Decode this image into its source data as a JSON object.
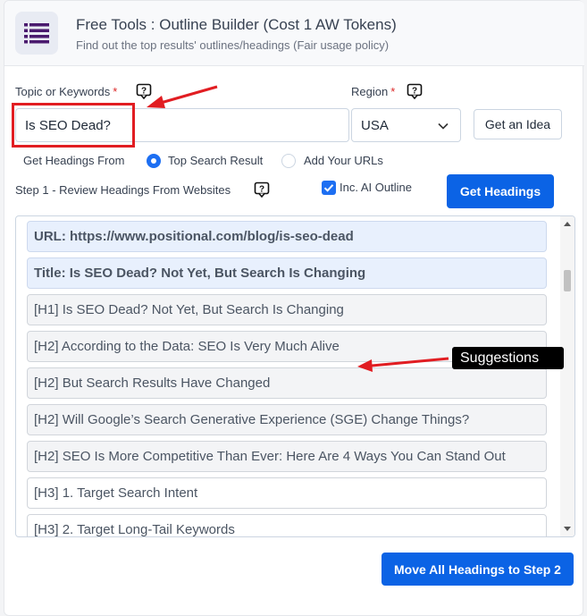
{
  "header": {
    "title": "Free Tools : Outline Builder (Cost 1 AW Tokens)",
    "subtitle": "Find out the top results' outlines/headings (Fair usage policy)",
    "logo_icon": "list-icon"
  },
  "form": {
    "topic_label": "Topic or Keywords",
    "required_mark": "*",
    "topic_value": "Is SEO Dead?",
    "region_label": "Region",
    "region_value": "USA",
    "idea_button": "Get an Idea",
    "get_headings_from_label": "Get Headings From",
    "source_options": [
      {
        "label": "Top Search Result",
        "selected": true
      },
      {
        "label": "Add Your URLs",
        "selected": false
      }
    ],
    "step1_label": "Step 1 - Review Headings From Websites",
    "ai_outline_label": "Inc. AI Outline",
    "ai_outline_checked": true,
    "get_headings_button": "Get Headings"
  },
  "headings": [
    {
      "tag": "",
      "text": "URL: https://www.positional.com/blog/is-seo-dead",
      "kind": "meta"
    },
    {
      "tag": "",
      "text": "Title: Is SEO Dead? Not Yet, But Search Is Changing",
      "kind": "meta"
    },
    {
      "tag": "[H1]",
      "text": "Is SEO Dead? Not Yet, But Search Is Changing",
      "kind": "gray"
    },
    {
      "tag": "[H2]",
      "text": "According to the Data: SEO Is Very Much Alive",
      "kind": "gray"
    },
    {
      "tag": "[H2]",
      "text": "But Search Results Have Changed",
      "kind": "gray"
    },
    {
      "tag": "[H2]",
      "text": "Will Google’s Search Generative Experience (SGE) Change Things?",
      "kind": "gray"
    },
    {
      "tag": "[H2]",
      "text": "SEO Is More Competitive Than Ever: Here Are 4 Ways You Can Stand Out",
      "kind": "gray"
    },
    {
      "tag": "[H3]",
      "text": "1. Target Search Intent",
      "kind": "white"
    },
    {
      "tag": "[H3]",
      "text": "2. Target Long-Tail Keywords",
      "kind": "white"
    }
  ],
  "annotation": {
    "suggestions_label": "Suggestions"
  },
  "footer": {
    "move_button": "Move All Headings to Step 2"
  },
  "colors": {
    "primary": "#0b63e5",
    "annotation_red": "#e11d22",
    "meta_bg": "#e8f0fd"
  }
}
